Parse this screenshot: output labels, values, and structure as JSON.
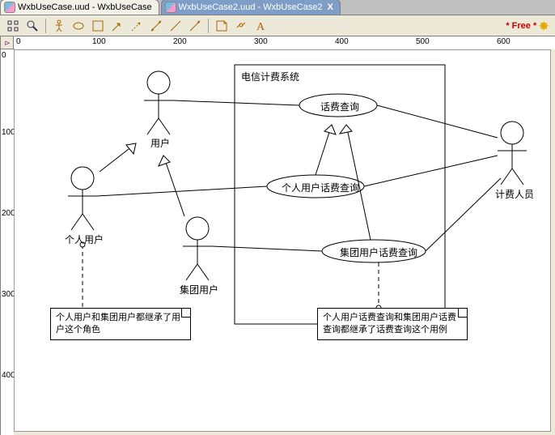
{
  "tabs": {
    "inactive": "WxbUseCase.uud - WxbUseCase",
    "active": "WxbUseCase2.uud - WxbUseCase2",
    "close_x": "X"
  },
  "toolbar": {
    "free_label": "* Free *"
  },
  "ruler": {
    "h": [
      "0",
      "100",
      "200",
      "300",
      "400",
      "500",
      "600"
    ],
    "v": [
      "0",
      "100",
      "200",
      "300",
      "400"
    ]
  },
  "system": {
    "title": "电信计费系统"
  },
  "actors": {
    "user": "用户",
    "personal": "个人用户",
    "group": "集团用户",
    "billing": "计费人员"
  },
  "usecases": {
    "query": "话费查询",
    "personalQuery": "个人用户话费查询",
    "groupQuery": "集团用户话费查询"
  },
  "notes": {
    "actors": "个人用户和集团用户都继承了用户这个角色",
    "usecases": "个人用户话费查询和集团用户话费查询都继承了话费查询这个用例"
  },
  "corner": "⊳"
}
